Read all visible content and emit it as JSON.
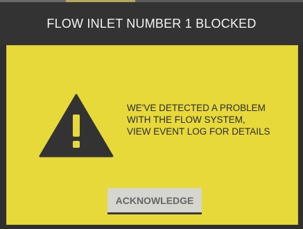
{
  "alert": {
    "title": "FLOW INLET NUMBER 1 BLOCKED",
    "icon": "warning-triangle-icon",
    "message_lines": [
      "WE'VE DETECTED A PROBLEM",
      "WITH THE FLOW SYSTEM,",
      "VIEW EVENT LOG FOR DETAILS"
    ],
    "acknowledge_label": "ACKNOWLEDGE"
  },
  "colors": {
    "header_bg": "#333333",
    "panel_bg": "#e6d939",
    "icon": "#333333",
    "button_bg": "#d6d6d0",
    "button_text": "#666666"
  }
}
